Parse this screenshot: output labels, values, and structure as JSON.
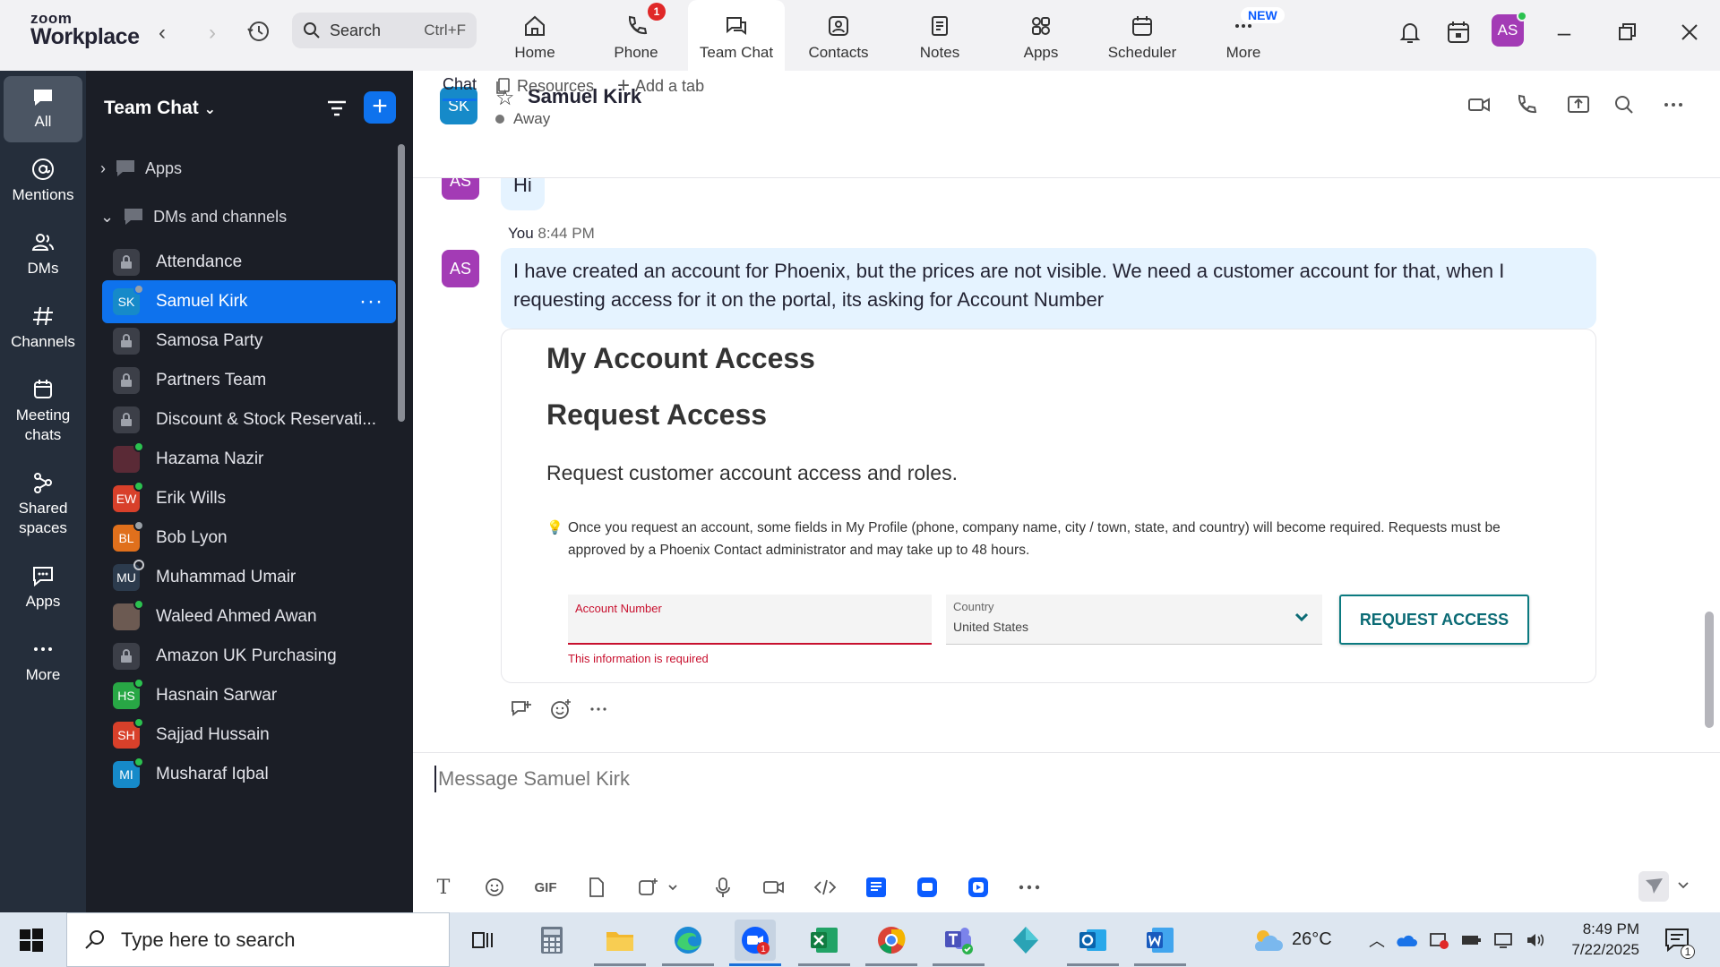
{
  "app": {
    "logo_line1": "zoom",
    "logo_line2": "Workplace",
    "search_label": "Search",
    "search_shortcut": "Ctrl+F",
    "new_badge": "NEW",
    "user_initials": "AS"
  },
  "nav_tabs": [
    {
      "label": "Home",
      "icon": "home-icon"
    },
    {
      "label": "Phone",
      "icon": "phone-icon",
      "badge": "1"
    },
    {
      "label": "Team Chat",
      "icon": "chat-icon",
      "active": true
    },
    {
      "label": "Contacts",
      "icon": "contacts-icon"
    },
    {
      "label": "Notes",
      "icon": "notes-icon"
    },
    {
      "label": "Apps",
      "icon": "apps-icon"
    },
    {
      "label": "Scheduler",
      "icon": "calendar-icon"
    },
    {
      "label": "More",
      "icon": "more-icon"
    }
  ],
  "rail": [
    {
      "label": "All",
      "icon": "chat-bubble-icon",
      "active": true
    },
    {
      "label": "Mentions",
      "icon": "at-icon"
    },
    {
      "label": "DMs",
      "icon": "people-icon"
    },
    {
      "label": "Channels",
      "icon": "hash-icon"
    },
    {
      "label": "Meeting chats",
      "icon": "calendar-icon"
    },
    {
      "label": "Shared spaces",
      "icon": "shared-spaces-icon"
    },
    {
      "label": "Apps",
      "icon": "apps-chat-icon"
    },
    {
      "label": "More",
      "icon": "more-dots-icon"
    }
  ],
  "sidebar": {
    "title": "Team Chat",
    "section_apps": "Apps",
    "section_dms": "DMs and channels",
    "items": [
      {
        "label": "Attendance",
        "avatar": "",
        "avatar_color": "#3c3f48",
        "lock": true
      },
      {
        "label": "Samuel Kirk",
        "avatar": "SK",
        "avatar_color": "#168ac9",
        "status": "away",
        "selected": true
      },
      {
        "label": "Samosa Party",
        "avatar": "",
        "avatar_color": "#3c3f48",
        "lock": true
      },
      {
        "label": "Partners Team",
        "avatar": "",
        "avatar_color": "#3c3f48",
        "lock": true
      },
      {
        "label": "Discount & Stock Reservati...",
        "avatar": "",
        "avatar_color": "#3c3f48",
        "lock": true
      },
      {
        "label": "Hazama Nazir",
        "avatar": "",
        "avatar_color": "#5a2a36",
        "status": "online"
      },
      {
        "label": "Erik Wills",
        "avatar": "EW",
        "avatar_color": "#d8402a",
        "status": "online"
      },
      {
        "label": "Bob Lyon",
        "avatar": "BL",
        "avatar_color": "#e0701c",
        "status": "away"
      },
      {
        "label": "Muhammad Umair",
        "avatar": "MU",
        "avatar_color": "#2c3b4d",
        "status": "offline"
      },
      {
        "label": "Waleed Ahmed Awan",
        "avatar": "",
        "avatar_color": "#6c5a52",
        "status": "online"
      },
      {
        "label": "Amazon UK Purchasing",
        "avatar": "",
        "avatar_color": "#3c3f48",
        "lock": true
      },
      {
        "label": "Hasnain Sarwar",
        "avatar": "HS",
        "avatar_color": "#28a745",
        "status": "online"
      },
      {
        "label": "Sajjad Hussain",
        "avatar": "SH",
        "avatar_color": "#d8402a",
        "status": "mobile"
      },
      {
        "label": "Musharaf Iqbal",
        "avatar": "MI",
        "avatar_color": "#168ac9",
        "status": "online"
      }
    ]
  },
  "chat": {
    "contact_initials": "SK",
    "contact_name": "Samuel Kirk",
    "contact_status": "Away",
    "tabs": [
      "Chat",
      "Resources",
      "Add a tab"
    ],
    "prev_message": "Hi",
    "prev_avatar": "AS",
    "message": {
      "sender": "You",
      "time": "8:44 PM",
      "avatar": "AS",
      "text": "I have created an account for Phoenix, but the prices are not visible. We need a customer account for that, when I requesting access for it on the portal, its asking for Account Number"
    },
    "attachment": {
      "heading1": "My Account Access",
      "heading2": "Request Access",
      "subtitle": "Request customer account access and roles.",
      "note": "Once you request an account, some fields in My Profile (phone, company name, city / town, state, and country) will become required. Requests must be approved by a Phoenix Contact administrator and may take up to 48 hours.",
      "account_label": "Account Number",
      "account_error": "This information is required",
      "country_label": "Country",
      "country_value": "United States",
      "button": "REQUEST ACCESS"
    },
    "composer_placeholder": "Message Samuel Kirk",
    "toolbar_gif": "GIF"
  },
  "taskbar": {
    "search_placeholder": "Type here to search",
    "temperature": "26°C",
    "time": "8:49 PM",
    "date": "7/22/2025",
    "notifications": "1"
  }
}
